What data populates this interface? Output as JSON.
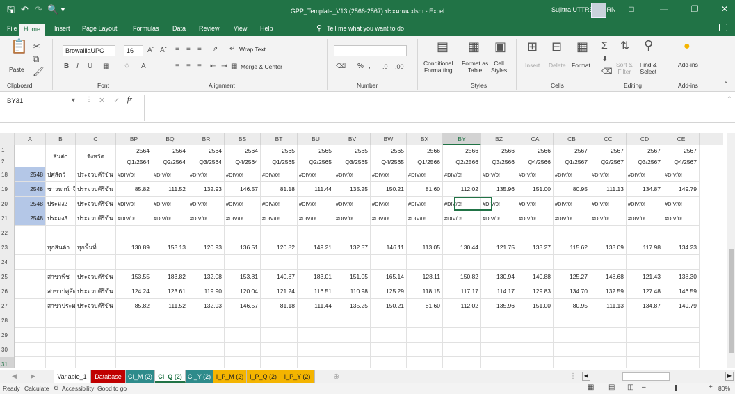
{
  "title_bar": {
    "doc_title": "GPP_Template_V13 (2566-2567) ประมาณ.xlsm - Excel",
    "user_name": "Sujittra UTTREESORN",
    "save_icon": "save-icon",
    "undo_icon": "undo-icon",
    "redo_icon": "redo-icon",
    "preview_icon": "print-preview-icon"
  },
  "ribbon_tabs": [
    "File",
    "Home",
    "Insert",
    "Page Layout",
    "Formulas",
    "Data",
    "Review",
    "View",
    "Help"
  ],
  "tell_me": "Tell me what you want to do",
  "ribbon": {
    "clipboard": {
      "paste": "Paste",
      "group": "Clipboard"
    },
    "font": {
      "name": "BrowalliaUPC",
      "size": "16",
      "group": "Font"
    },
    "alignment": {
      "wrap": "Wrap Text",
      "merge": "Merge & Center",
      "group": "Alignment"
    },
    "number": {
      "percent": "%",
      "group": "Number"
    },
    "styles": {
      "conditional": "Conditional\nFormatting",
      "format_as": "Format as\nTable",
      "cell_styles": "Cell\nStyles",
      "group": "Styles"
    },
    "cells": {
      "insert": "Insert",
      "delete": "Delete",
      "format": "Format",
      "group": "Cells"
    },
    "editing": {
      "sort": "Sort &\nFilter",
      "find": "Find &\nSelect",
      "group": "Editing"
    },
    "addins": {
      "label": "Add-ins",
      "group": "Add-ins"
    }
  },
  "name_box": "BY31",
  "formula_fx": "fx",
  "columns": [
    {
      "id": "A",
      "w": 45
    },
    {
      "id": "B",
      "w": 43
    },
    {
      "id": "C",
      "w": 58
    },
    {
      "id": "BP",
      "w": 52
    },
    {
      "id": "BQ",
      "w": 52
    },
    {
      "id": "BR",
      "w": 52
    },
    {
      "id": "BS",
      "w": 52
    },
    {
      "id": "BT",
      "w": 53
    },
    {
      "id": "BU",
      "w": 53
    },
    {
      "id": "BV",
      "w": 52
    },
    {
      "id": "BW",
      "w": 52
    },
    {
      "id": "BX",
      "w": 52
    },
    {
      "id": "BY",
      "w": 55,
      "selected": true
    },
    {
      "id": "BZ",
      "w": 52
    },
    {
      "id": "CA",
      "w": 52
    },
    {
      "id": "CB",
      "w": 53
    },
    {
      "id": "CC",
      "w": 52
    },
    {
      "id": "CD",
      "w": 53
    },
    {
      "id": "CE",
      "w": 52
    }
  ],
  "header_rows": {
    "row1_labels": {
      "B": "สินค้า",
      "C": "จังหวัด"
    },
    "years": [
      "2564",
      "2564",
      "2564",
      "2564",
      "2565",
      "2565",
      "2565",
      "2565",
      "2566",
      "2566",
      "2566",
      "2566",
      "2567",
      "2567",
      "2567",
      "2567"
    ],
    "quarters": [
      "Q1/2564",
      "Q2/2564",
      "Q3/2564",
      "Q4/2564",
      "Q1/2565",
      "Q2/2565",
      "Q3/2565",
      "Q4/2565",
      "Q1/2566",
      "Q2/2566",
      "Q3/2566",
      "Q4/2566",
      "Q1/2567",
      "Q2/2567",
      "Q3/2567",
      "Q4/2567"
    ]
  },
  "rows": [
    {
      "num": "18",
      "a": "2548",
      "b": "ปศุสัตว์",
      "c": "ประจวบคีรีขัน",
      "hl": true,
      "vals": [
        "#DIV/0!",
        "#DIV/0!",
        "#DIV/0!",
        "#DIV/0!",
        "#DIV/0!",
        "#DIV/0!",
        "#DIV/0!",
        "#DIV/0!",
        "#DIV/0!",
        "#DIV/0!",
        "#DIV/0!",
        "#DIV/0!",
        "#DIV/0!",
        "#DIV/0!",
        "#DIV/0!",
        "#DIV/0!"
      ]
    },
    {
      "num": "19",
      "a": "2548",
      "b": "ชาวนาน้าจืด",
      "c": "ประจวบคีรีขัน",
      "hl": true,
      "vals": [
        "85.82",
        "111.52",
        "132.93",
        "146.57",
        "81.18",
        "111.44",
        "135.25",
        "150.21",
        "81.60",
        "112.02",
        "135.96",
        "151.00",
        "80.95",
        "111.13",
        "134.87",
        "149.79"
      ]
    },
    {
      "num": "20",
      "a": "2548",
      "b": "ประมง2",
      "c": "ประจวบคีรีขัน",
      "hl": true,
      "vals": [
        "#DIV/0!",
        "#DIV/0!",
        "#DIV/0!",
        "#DIV/0!",
        "#DIV/0!",
        "#DIV/0!",
        "#DIV/0!",
        "#DIV/0!",
        "#DIV/0!",
        "#DIV/0!",
        "#DIV/0!",
        "#DIV/0!",
        "#DIV/0!",
        "#DIV/0!",
        "#DIV/0!",
        "#DIV/0!"
      ]
    },
    {
      "num": "21",
      "a": "2548",
      "b": "ประมง3",
      "c": "ประจวบคีรีขัน",
      "hl": true,
      "vals": [
        "#DIV/0!",
        "#DIV/0!",
        "#DIV/0!",
        "#DIV/0!",
        "#DIV/0!",
        "#DIV/0!",
        "#DIV/0!",
        "#DIV/0!",
        "#DIV/0!",
        "#DIV/0!",
        "#DIV/0!",
        "#DIV/0!",
        "#DIV/0!",
        "#DIV/0!",
        "#DIV/0!",
        "#DIV/0!"
      ]
    },
    {
      "num": "22",
      "a": "",
      "b": "",
      "c": "",
      "vals": []
    },
    {
      "num": "23",
      "a": "",
      "b": "ทุกสินค้า",
      "c": "ทุกพื้นที่",
      "vals": [
        "130.89",
        "153.13",
        "120.93",
        "136.51",
        "120.82",
        "149.21",
        "132.57",
        "146.11",
        "113.05",
        "130.44",
        "121.75",
        "133.27",
        "115.62",
        "133.09",
        "117.98",
        "134.23"
      ]
    },
    {
      "num": "24",
      "a": "",
      "b": "",
      "c": "",
      "vals": []
    },
    {
      "num": "25",
      "a": "",
      "b": "สาขาพืช",
      "c": "ประจวบคีรีขัน",
      "vals": [
        "153.55",
        "183.82",
        "132.08",
        "153.81",
        "140.87",
        "183.01",
        "151.05",
        "165.14",
        "128.11",
        "150.82",
        "130.94",
        "140.88",
        "125.27",
        "148.68",
        "121.43",
        "138.30"
      ]
    },
    {
      "num": "26",
      "a": "",
      "b": "สาขาปศุสัตว์",
      "c": "ประจวบคีรีขัน",
      "vals": [
        "124.24",
        "123.61",
        "119.90",
        "120.04",
        "121.24",
        "116.51",
        "110.98",
        "125.29",
        "118.15",
        "117.17",
        "114.17",
        "129.83",
        "134.70",
        "132.59",
        "127.48",
        "146.59"
      ]
    },
    {
      "num": "27",
      "a": "",
      "b": "สาขาประมง",
      "c": "ประจวบคีรีขัน",
      "vals": [
        "85.82",
        "111.52",
        "132.93",
        "146.57",
        "81.18",
        "111.44",
        "135.25",
        "150.21",
        "81.60",
        "112.02",
        "135.96",
        "151.00",
        "80.95",
        "111.13",
        "134.87",
        "149.79"
      ]
    },
    {
      "num": "28",
      "a": "",
      "b": "",
      "c": "",
      "vals": []
    },
    {
      "num": "29",
      "a": "",
      "b": "",
      "c": "",
      "vals": []
    },
    {
      "num": "30",
      "a": "",
      "b": "",
      "c": "",
      "vals": []
    },
    {
      "num": "31",
      "a": "",
      "b": "",
      "c": "",
      "vals": [],
      "selected": true
    },
    {
      "num": "32",
      "a": "",
      "b": "",
      "c": "",
      "vals": []
    }
  ],
  "sheet_tabs": [
    {
      "label": "Variable_1",
      "bg": "#ffffff",
      "fg": "#222222"
    },
    {
      "label": "Database",
      "bg": "#c00000",
      "fg": "#ffffff"
    },
    {
      "label": "CI_M (2)",
      "bg": "#2e8b8b",
      "fg": "#ffffff"
    },
    {
      "label": "CI_Q (2)",
      "bg": "#ffffff",
      "fg": "#217346",
      "active": true
    },
    {
      "label": "CI_Y (2)",
      "bg": "#2e8b8b",
      "fg": "#ffffff"
    },
    {
      "label": "I_P_M (2)",
      "bg": "#f4b400",
      "fg": "#222222"
    },
    {
      "label": "I_P_Q (2)",
      "bg": "#f4b400",
      "fg": "#222222"
    },
    {
      "label": "I_P_Y (2)",
      "bg": "#f4b400",
      "fg": "#222222"
    }
  ],
  "status": {
    "ready": "Ready",
    "calculate": "Calculate",
    "accessibility": "Accessibility: Good to go",
    "zoom": "80%"
  },
  "colors": {
    "excel_green": "#217346",
    "selected_fill": "#b4c7e7"
  }
}
